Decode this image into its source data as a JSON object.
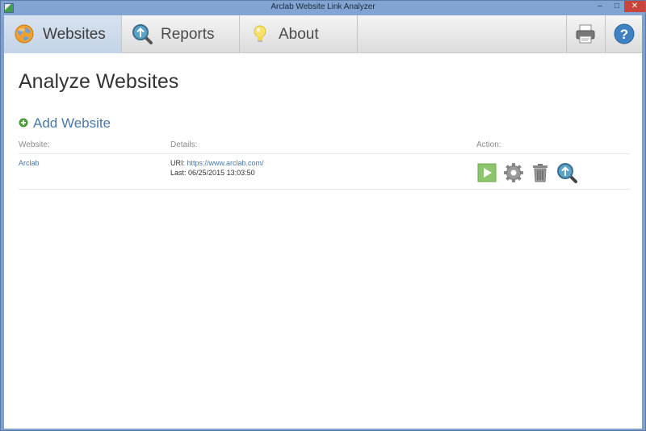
{
  "window": {
    "title": "Arclab Website Link Analyzer",
    "minimize": "–",
    "maximize": "□",
    "close": "✕"
  },
  "toolbar": {
    "tabs": [
      {
        "label": "Websites",
        "icon": "globe-icon",
        "active": true
      },
      {
        "label": "Reports",
        "icon": "magnifier-icon",
        "active": false
      },
      {
        "label": "About",
        "icon": "lightbulb-icon",
        "active": false
      }
    ],
    "tools": [
      {
        "icon": "printer-icon"
      },
      {
        "icon": "help-icon"
      }
    ]
  },
  "page": {
    "title": "Analyze Websites",
    "add_website_label": "Add Website"
  },
  "table": {
    "headers": {
      "website": "Website:",
      "details": "Details:",
      "action": "Action:"
    },
    "rows": [
      {
        "website": "Arclab",
        "uri_label": "URI:",
        "uri": "https://www.arclab.com/",
        "last_label": "Last:",
        "last": "06/25/2015 13:03:50",
        "actions": [
          "play-icon",
          "gear-icon",
          "trash-icon",
          "report-magnifier-icon"
        ]
      }
    ]
  },
  "colors": {
    "accent": "#4a78a8",
    "active_tab": "#c9d8ea",
    "play_green": "#8cc56a",
    "add_green": "#4a9a3a",
    "close_red": "#c7453a"
  }
}
